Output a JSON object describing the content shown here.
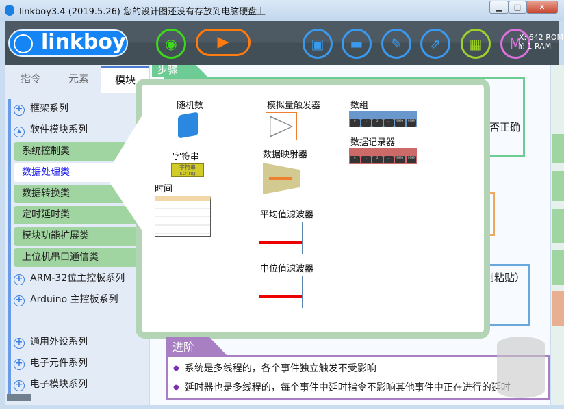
{
  "window": {
    "title": "linkboy3.4 (2019.5.26) 您的设计图还没有存放到电脑硬盘上",
    "min": "▁",
    "max": "□",
    "close": "✕"
  },
  "toolbar": {
    "logo": "linkboy",
    "coords": {
      "x": "X: 642",
      "y": "Y: 1",
      "rom": "ROM",
      "ram": "RAM"
    }
  },
  "tabs": [
    "指令",
    "元素",
    "模块"
  ],
  "tree": {
    "nodes_top": [
      {
        "icon": "+",
        "label": "框架系列"
      },
      {
        "icon": "▲",
        "label": "软件模块系列"
      }
    ],
    "categories": [
      "系统控制类",
      "数据处理类",
      "数据转换类",
      "定时延时类",
      "模块功能扩展类",
      "上位机串口通信类"
    ],
    "nodes_mid": [
      {
        "icon": "+",
        "label": "ARM-32位主控板系列"
      },
      {
        "icon": "+",
        "label": "Arduino 主控板系列"
      }
    ],
    "nodes_bottom": [
      {
        "icon": "+",
        "label": "通用外设系列"
      },
      {
        "icon": "+",
        "label": "电子元件系列"
      },
      {
        "icon": "+",
        "label": "电子模块系列"
      }
    ]
  },
  "main": {
    "step_tab": "步骤",
    "bg_text1": "是否正确",
    "bg_text2": "制粘贴）"
  },
  "popup": {
    "random": "随机数",
    "string": "字符串",
    "string_icon_cn": "字符串",
    "string_icon_en": "string",
    "time": "时间",
    "analog_trigger": "模拟量触发器",
    "data_mapper": "数据映射器",
    "avg_filter": "平均值滤波器",
    "median_filter": "中位值滤波器",
    "array": "数组",
    "data_recorder": "数据记录器",
    "array_cells": [
      "0",
      "1",
      "2",
      "...",
      "9999",
      "9999"
    ]
  },
  "advanced": {
    "tab": "进阶",
    "items": [
      "系统是多线程的，各个事件独立触发不受影响",
      "延时器也是多线程的，每个事件中延时指令不影响其他事件中正在进行的延时"
    ]
  }
}
